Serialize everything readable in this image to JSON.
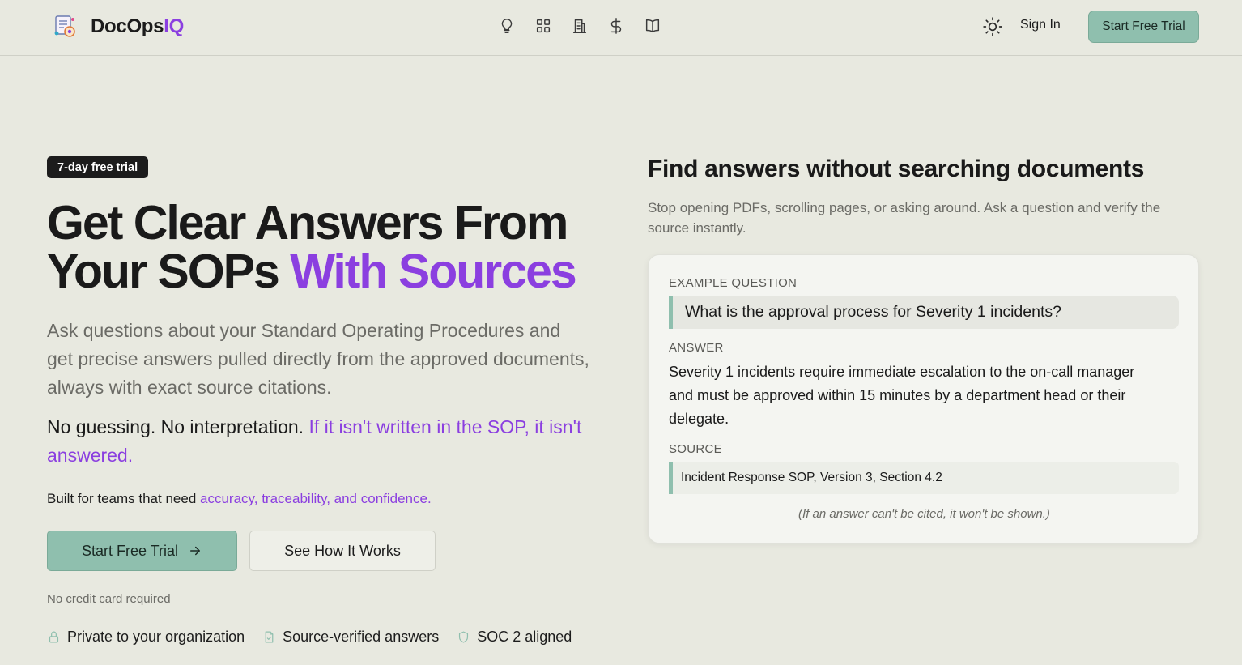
{
  "header": {
    "brand_main": "DocOps",
    "brand_accent": "IQ",
    "nav_icons": [
      "lightbulb-icon",
      "grid-icon",
      "building-icon",
      "dollar-icon",
      "book-icon"
    ],
    "theme_icon": "sun-icon",
    "sign_in": "Sign In",
    "cta": "Start Free Trial"
  },
  "hero": {
    "badge": "7-day free trial",
    "title_line1": "Get Clear Answers From",
    "title_line2_plain": "Your SOPs ",
    "title_line2_accent": "With Sources",
    "subtitle": "Ask questions about your Standard Operating Procedures and get precise answers pulled directly from the approved documents, always with exact source citations.",
    "tagline_plain": "No guessing. No interpretation. ",
    "tagline_accent": "If it isn't written in the SOP, it isn't answered.",
    "built_for_plain": "Built for teams that need ",
    "built_for_accent": "accuracy, traceability, and confidence.",
    "primary_button": "Start Free Trial",
    "secondary_button": "See How It Works",
    "no_credit_card": "No credit card required",
    "trust": [
      {
        "icon": "lock-icon",
        "label": "Private to your organization"
      },
      {
        "icon": "document-check-icon",
        "label": "Source-verified answers"
      },
      {
        "icon": "shield-icon",
        "label": "SOC 2 aligned"
      }
    ]
  },
  "example": {
    "title": "Find answers without searching documents",
    "subtitle": "Stop opening PDFs, scrolling pages, or asking around. Ask a question and verify the source instantly.",
    "question_label": "EXAMPLE QUESTION",
    "question": "What is the approval process for Severity 1 incidents?",
    "answer_label": "ANSWER",
    "answer": "Severity 1 incidents require immediate escalation to the on-call manager and must be approved within 15 minutes by a department head or their delegate.",
    "source_label": "SOURCE",
    "source": "Incident Response SOP, Version 3, Section 4.2",
    "note": "(If an answer can't be cited, it won't be shown.)"
  },
  "colors": {
    "background": "#e8e9e0",
    "accent_purple": "#8b3fe0",
    "accent_green": "#8fbfae",
    "text_dark": "#1a1a1a",
    "text_muted": "#6b6b66"
  }
}
